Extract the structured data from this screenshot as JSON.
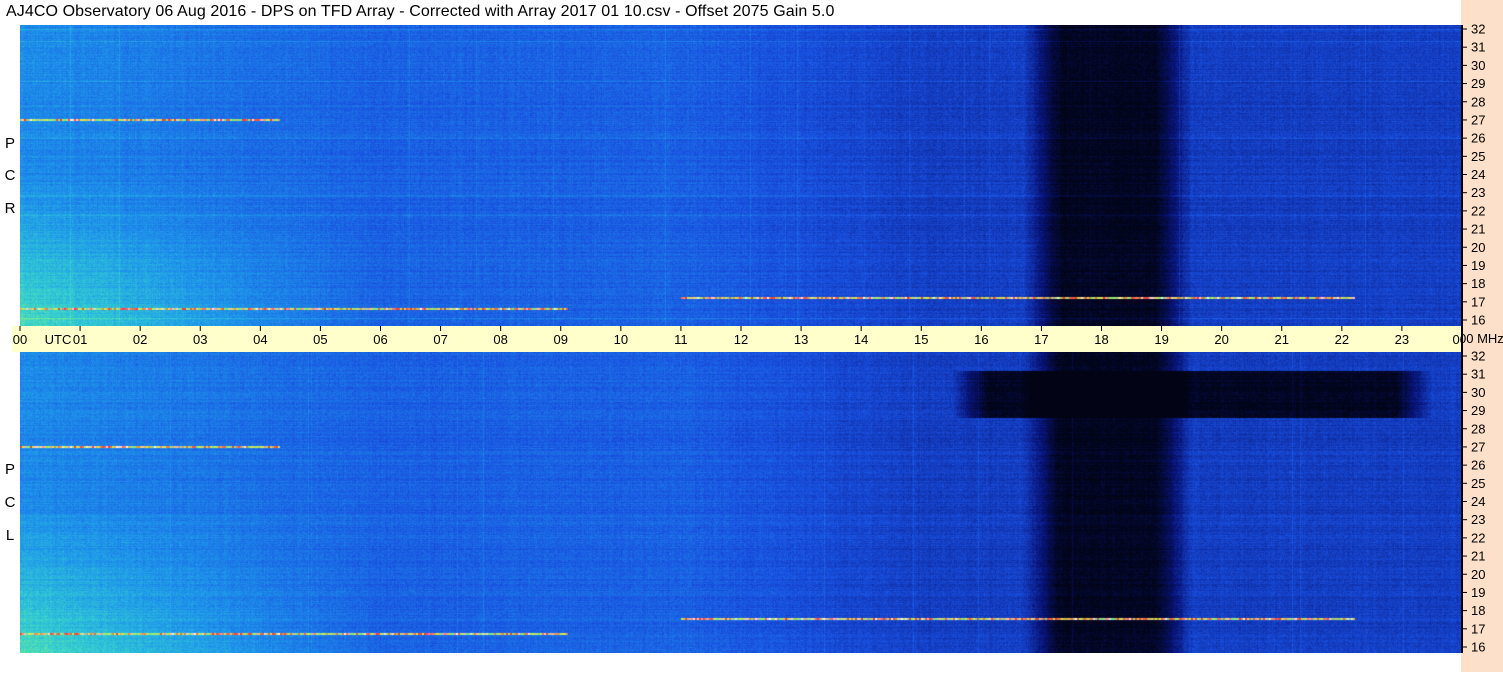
{
  "title": "AJ4CO Observatory  06 Aug 2016  -  DPS on TFD Array  -  Corrected with Array 2017 01 10.csv  -  Offset 2075  Gain 5.0",
  "colors": {
    "background": "#ffffff",
    "time_axis_bg": "#ffffcc",
    "freq_axis_bg": "#fde0c9",
    "spectrogram_base": "#1f5fe0",
    "spectrogram_dark": "#02051a",
    "spectrogram_bright": "#5ef0c0"
  },
  "chart_data": [
    {
      "type": "heatmap",
      "panel": "top",
      "polarization_label": [
        "R",
        "C",
        "P"
      ],
      "x_axis": {
        "unit_label": "UTC",
        "range_hours": [
          0,
          24
        ],
        "tick_labels": [
          "00",
          "01",
          "02",
          "03",
          "04",
          "05",
          "06",
          "07",
          "08",
          "09",
          "10",
          "11",
          "12",
          "13",
          "14",
          "15",
          "16",
          "17",
          "18",
          "19",
          "20",
          "21",
          "22",
          "23",
          "00"
        ]
      },
      "y_axis": {
        "unit_label": "MHz",
        "range_mhz": [
          16,
          32
        ],
        "tick_labels": [
          "32",
          "31",
          "30",
          "29",
          "28",
          "27",
          "26",
          "25",
          "24",
          "23",
          "22",
          "21",
          "20",
          "19",
          "18",
          "17",
          "16"
        ]
      },
      "features": [
        {
          "kind": "dark region",
          "utc_start": 16.7,
          "utc_end": 19.5,
          "mhz_start": 16,
          "mhz_end": 32
        },
        {
          "kind": "bright region",
          "utc_start": 0,
          "utc_end": 6,
          "mhz_start": 16,
          "mhz_end": 24
        },
        {
          "kind": "interference",
          "mhz": 27.0,
          "utc_start": 0,
          "utc_end": 4.3
        },
        {
          "kind": "interference",
          "mhz": 17.5,
          "utc_start": 11.0,
          "utc_end": 22.2
        },
        {
          "kind": "interference",
          "mhz": 16.9,
          "utc_start": 0,
          "utc_end": 9.1
        }
      ]
    },
    {
      "type": "heatmap",
      "panel": "bottom",
      "polarization_label": [
        "L",
        "C",
        "P"
      ],
      "x_axis": {
        "unit_label": "UTC",
        "range_hours": [
          0,
          24
        ]
      },
      "y_axis": {
        "unit_label": "MHz",
        "range_mhz": [
          16,
          32
        ],
        "tick_labels": [
          "32",
          "31",
          "30",
          "29",
          "28",
          "27",
          "26",
          "25",
          "24",
          "23",
          "22",
          "21",
          "20",
          "19",
          "18",
          "17",
          "16"
        ]
      },
      "features": [
        {
          "kind": "dark region",
          "utc_start": 15.5,
          "utc_end": 23.5,
          "mhz_start": 28.5,
          "mhz_end": 31
        },
        {
          "kind": "dark region",
          "utc_start": 16.7,
          "utc_end": 19.5,
          "mhz_start": 16,
          "mhz_end": 32
        },
        {
          "kind": "bright region",
          "utc_start": 0,
          "utc_end": 6,
          "mhz_start": 16,
          "mhz_end": 24
        },
        {
          "kind": "interference",
          "mhz": 27.0,
          "utc_start": 0,
          "utc_end": 4.3
        },
        {
          "kind": "interference",
          "mhz": 17.8,
          "utc_start": 11.0,
          "utc_end": 22.2
        },
        {
          "kind": "interference",
          "mhz": 17.0,
          "utc_start": 0,
          "utc_end": 9.1
        }
      ]
    }
  ]
}
